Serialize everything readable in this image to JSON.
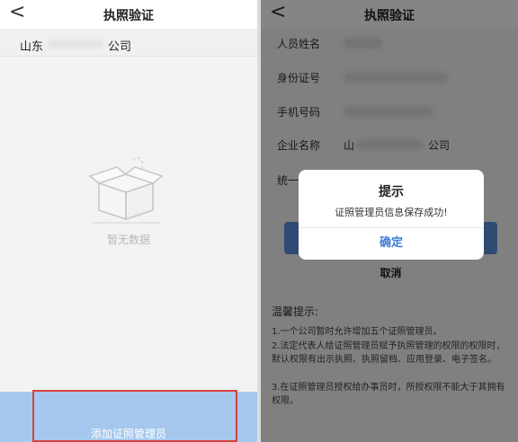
{
  "left_screen": {
    "title": "执照验证",
    "back_symbol": "<",
    "company": {
      "prefix": "山东",
      "suffix": "公司"
    },
    "empty_state": {
      "icon": "empty-box-icon",
      "text": "暂无数据"
    },
    "add_button_label": "添加证照管理员"
  },
  "right_screen": {
    "title": "执照验证",
    "back_symbol": "<",
    "form": {
      "name_label": "人员姓名",
      "id_label": "身份证号",
      "phone_label": "手机号码",
      "company_label": "企业名称",
      "company_prefix": "山",
      "company_suffix": "公司",
      "credit_code_label": "统一"
    },
    "cancel_label": "取消",
    "tips": {
      "title": "温馨提示:",
      "items": [
        "1.一个公司暂时允许增加五个证照管理员。",
        "2.法定代表人给证照管理员赋予执照管理的权限的权限时，默认权限有出示执照、执照留档、应用登录、电子签名。",
        "3.在证照管理员授权给办事员时，所授权限不能大于其拥有权限。"
      ]
    },
    "dialog": {
      "title": "提示",
      "message": "证照管理员信息保存成功!",
      "confirm_label": "确定"
    }
  },
  "colors": {
    "primary_blue": "#5a91dd",
    "add_button_blue": "#a6c8ee",
    "confirm_text_blue": "#3c7bd8",
    "highlight_red": "#d8423e"
  }
}
